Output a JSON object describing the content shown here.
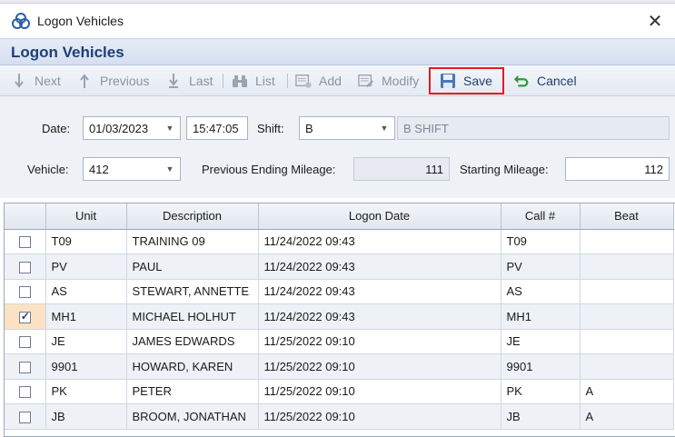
{
  "window": {
    "title": "Logon Vehicles"
  },
  "header": {
    "title": "Logon Vehicles"
  },
  "toolbar": {
    "next": "Next",
    "previous": "Previous",
    "last": "Last",
    "list": "List",
    "add": "Add",
    "modify": "Modify",
    "save": "Save",
    "cancel": "Cancel",
    "highlight_color": "#e11b22"
  },
  "form": {
    "date_label": "Date:",
    "date_value": "01/03/2023",
    "time_value": "15:47:05",
    "shift_label": "Shift:",
    "shift_value": "B",
    "shift_desc": "B SHIFT",
    "vehicle_label": "Vehicle:",
    "vehicle_value": "412",
    "prev_mileage_label": "Previous Ending Mileage:",
    "prev_mileage_value": "111",
    "start_mileage_label": "Starting Mileage:",
    "start_mileage_value": "112"
  },
  "table": {
    "columns": [
      "",
      "Unit",
      "Description",
      "Logon Date",
      "Call #",
      "Beat"
    ],
    "rows": [
      {
        "checked": false,
        "unit": "T09",
        "description": "TRAINING 09",
        "logon_date": "11/24/2022 09:43",
        "call": "T09",
        "beat": ""
      },
      {
        "checked": false,
        "unit": "PV",
        "description": "PAUL",
        "logon_date": "11/24/2022 09:43",
        "call": "PV",
        "beat": ""
      },
      {
        "checked": false,
        "unit": "AS",
        "description": "STEWART, ANNETTE",
        "logon_date": "11/24/2022 09:43",
        "call": "AS",
        "beat": ""
      },
      {
        "checked": true,
        "unit": "MH1",
        "description": "MICHAEL HOLHUT",
        "logon_date": "11/24/2022 09:43",
        "call": "MH1",
        "beat": ""
      },
      {
        "checked": false,
        "unit": "JE",
        "description": "JAMES EDWARDS",
        "logon_date": "11/25/2022 09:10",
        "call": "JE",
        "beat": ""
      },
      {
        "checked": false,
        "unit": "9901",
        "description": "HOWARD, KAREN",
        "logon_date": "11/25/2022 09:10",
        "call": "9901",
        "beat": ""
      },
      {
        "checked": false,
        "unit": "PK",
        "description": "PETER",
        "logon_date": "11/25/2022 09:10",
        "call": "PK",
        "beat": "A"
      },
      {
        "checked": false,
        "unit": "JB",
        "description": "BROOM, JONATHAN",
        "logon_date": "11/25/2022 09:10",
        "call": "JB",
        "beat": "A"
      }
    ]
  }
}
